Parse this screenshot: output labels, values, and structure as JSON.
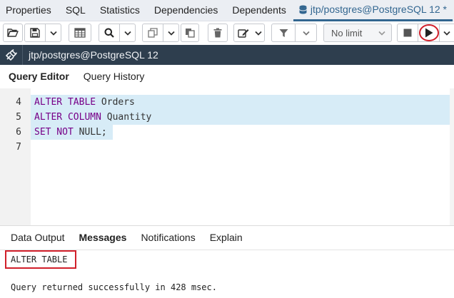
{
  "top_tabs": [
    {
      "label": "Properties"
    },
    {
      "label": "SQL"
    },
    {
      "label": "Statistics"
    },
    {
      "label": "Dependencies"
    },
    {
      "label": "Dependents"
    },
    {
      "label": "jtp/postgres@PostgreSQL 12 *"
    }
  ],
  "toolbar": {
    "limit_value": "No limit",
    "icons": [
      "open-folder-icon",
      "save-icon",
      "chevron-down-icon",
      "grid-icon",
      "search-icon",
      "chevron-down-icon",
      "copy-icon",
      "chevron-down-icon",
      "paste-icon",
      "delete-icon",
      "edit-icon",
      "chevron-down-icon",
      "filter-icon",
      "chevron-down-icon",
      "stop-icon",
      "play-icon",
      "chevron-down-icon"
    ]
  },
  "connection": {
    "label": "jtp/postgres@PostgreSQL 12"
  },
  "editor_tabs": [
    {
      "label": "Query Editor"
    },
    {
      "label": "Query History"
    }
  ],
  "editor": {
    "line_numbers": [
      "4",
      "5",
      "6",
      "7"
    ],
    "lines": [
      {
        "kw": "ALTER TABLE",
        "rest": " Orders"
      },
      {
        "kw": "ALTER COLUMN",
        "rest": " Quantity"
      },
      {
        "kw": "SET NOT",
        "rest": " NULL;"
      },
      {
        "kw": "",
        "rest": ""
      }
    ]
  },
  "results_tabs": [
    {
      "label": "Data Output"
    },
    {
      "label": "Messages"
    },
    {
      "label": "Notifications"
    },
    {
      "label": "Explain"
    }
  ],
  "messages": {
    "result": "ALTER TABLE",
    "status": "Query returned successfully in 428 msec."
  },
  "colors": {
    "accent": "#326690",
    "highlight_red": "#d11f2a",
    "keyword": "#770088",
    "selection": "#d7ecf7",
    "conn_bar": "#2e3e4e"
  }
}
